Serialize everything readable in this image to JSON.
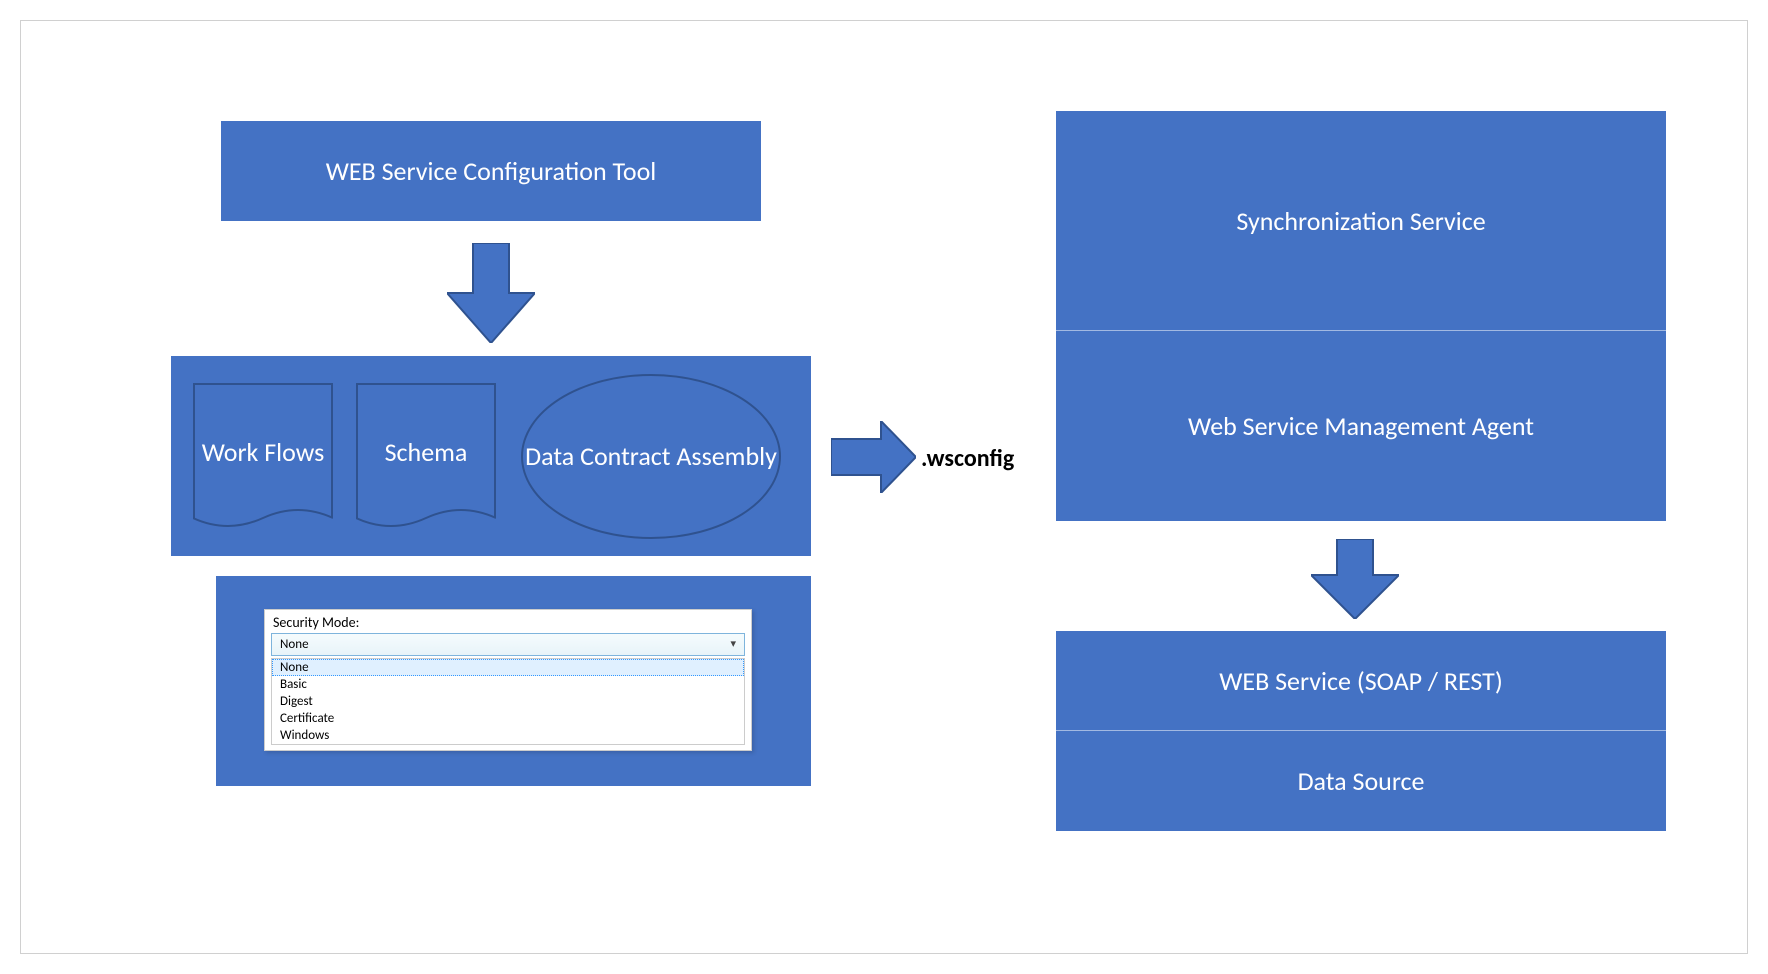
{
  "diagram": {
    "configToolLabel": "WEB Service Configuration Tool",
    "assets": {
      "workflows": "Work Flows",
      "schema": "Schema",
      "dataContract": "Data Contract Assembly"
    },
    "securityPanel": {
      "label": "Security Mode:",
      "selected": "None",
      "options": [
        "None",
        "Basic",
        "Digest",
        "Certificate",
        "Windows"
      ]
    },
    "connectorLabel": ".wsconfig",
    "stack": {
      "syncService": "Synchronization Service",
      "mgmtAgent": "Web Service Management Agent",
      "webService": "WEB Service (SOAP / REST)",
      "dataSource": "Data Source"
    }
  },
  "colors": {
    "primary": "#4472c4",
    "border": "#2f528f"
  }
}
